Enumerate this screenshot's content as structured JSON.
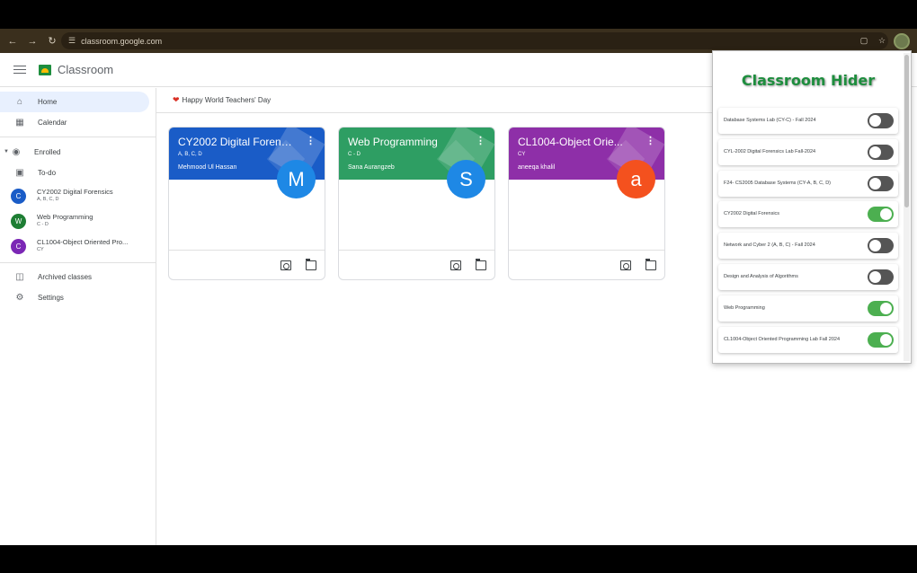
{
  "browser": {
    "url": "classroom.google.com",
    "icons": [
      "back-icon",
      "forward-icon",
      "reload-icon",
      "site-settings-icon",
      "cast-icon",
      "bookmark-star-icon",
      "extension-avatar"
    ]
  },
  "header": {
    "app_title": "Classroom"
  },
  "sidebar": {
    "home": "Home",
    "calendar": "Calendar",
    "enrolled": "Enrolled",
    "todo": "To-do",
    "classes": [
      {
        "initial": "C",
        "name": "CY2002 Digital Forensics",
        "section": "A, B, C, D",
        "color": "#1a5cc7"
      },
      {
        "initial": "W",
        "name": "Web Programming",
        "section": "C - D",
        "color": "#1e7e34"
      },
      {
        "initial": "C",
        "name": "CL1004-Object Oriented Pro...",
        "section": "CY",
        "color": "#7b27b5"
      }
    ],
    "archived": "Archived classes",
    "settings": "Settings"
  },
  "banner": {
    "text": "Happy World Teachers' Day"
  },
  "cards": [
    {
      "title": "CY2002 Digital Forens...",
      "section": "A, B, C, D",
      "teacher": "Mehmood Ul Hassan",
      "avatar": "M",
      "color": "#1a5cc7",
      "avatar_color": "#1e88e5"
    },
    {
      "title": "Web Programming",
      "section": "C - D",
      "teacher": "Sana Aurangzeb",
      "avatar": "S",
      "color": "#2e9e63",
      "avatar_color": "#1e88e5"
    },
    {
      "title": "CL1004-Object Orie...",
      "section": "CY",
      "teacher": "aneeqa khalil",
      "avatar": "a",
      "color": "#8e2fa8",
      "avatar_color": "#f4511e"
    }
  ],
  "popup": {
    "title": "Classroom Hider",
    "toggles": [
      {
        "label": "Database Systems Lab (CY-C) - Fall 2024",
        "on": false
      },
      {
        "label": "CYL-2002 Digital Forensics Lab Fall-2024",
        "on": false
      },
      {
        "label": "F24- CS2005 Database Systems (CY-A, B, C, D)",
        "on": false
      },
      {
        "label": "CY2002 Digital Forensics",
        "on": true
      },
      {
        "label": "Network and Cyber 2 (A, B, C) - Fall 2024",
        "on": false
      },
      {
        "label": "Design and Analysis of Algorithms",
        "on": false
      },
      {
        "label": "Web Programming",
        "on": true
      },
      {
        "label": "CL1004-Object Oriented Programming Lab Fall 2024",
        "on": true
      }
    ]
  }
}
